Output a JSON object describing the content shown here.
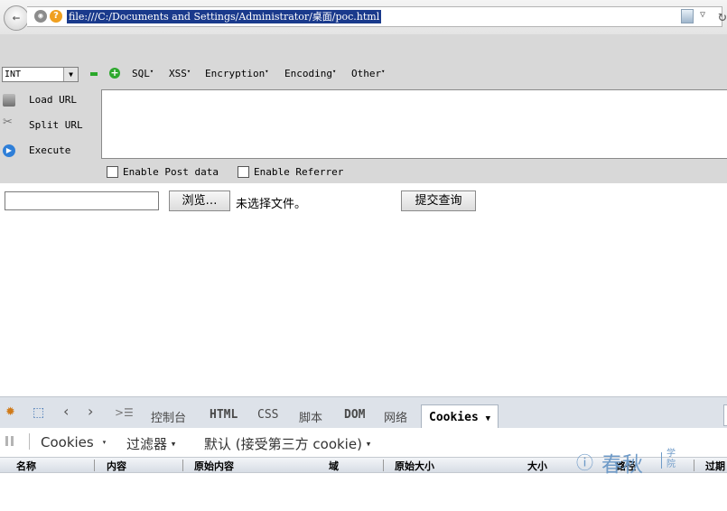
{
  "address_bar": {
    "url": "file:///C:/Documents and Settings/Administrator/桌面/poc.html"
  },
  "hackbar": {
    "select_value": "INT",
    "menus": [
      "SQL",
      "XSS",
      "Encryption",
      "Encoding",
      "Other"
    ],
    "buttons": {
      "load_url": "Load URL",
      "split_url": "Split URL",
      "execute": "Execute"
    },
    "checkboxes": {
      "post_data": "Enable Post data",
      "referrer": "Enable Referrer"
    },
    "textarea_value": ""
  },
  "page": {
    "browse_button": "浏览…",
    "no_file_text": "未选择文件。",
    "submit_button": "提交查询"
  },
  "firebug": {
    "tabs": [
      "控制台",
      "HTML",
      "CSS",
      "脚本",
      "DOM",
      "网络"
    ],
    "active_tab": "Cookies",
    "toolbar": {
      "cookies_menu": "Cookies",
      "filter_menu": "过滤器",
      "default_menu": "默认 (接受第三方 cookie)"
    },
    "columns": [
      "名称",
      "内容",
      "原始内容",
      "域",
      "原始大小",
      "大小",
      "路径",
      "过期"
    ]
  },
  "watermark": {
    "name": "春秋",
    "sub_1": "学",
    "sub_2": "院"
  },
  "colors": {
    "url_highlight": "#1a3a8c",
    "hackbar_bg": "#d8d8d8",
    "firebug_tabbar": "#dde2e9",
    "watermark": "#6f9bc8"
  }
}
